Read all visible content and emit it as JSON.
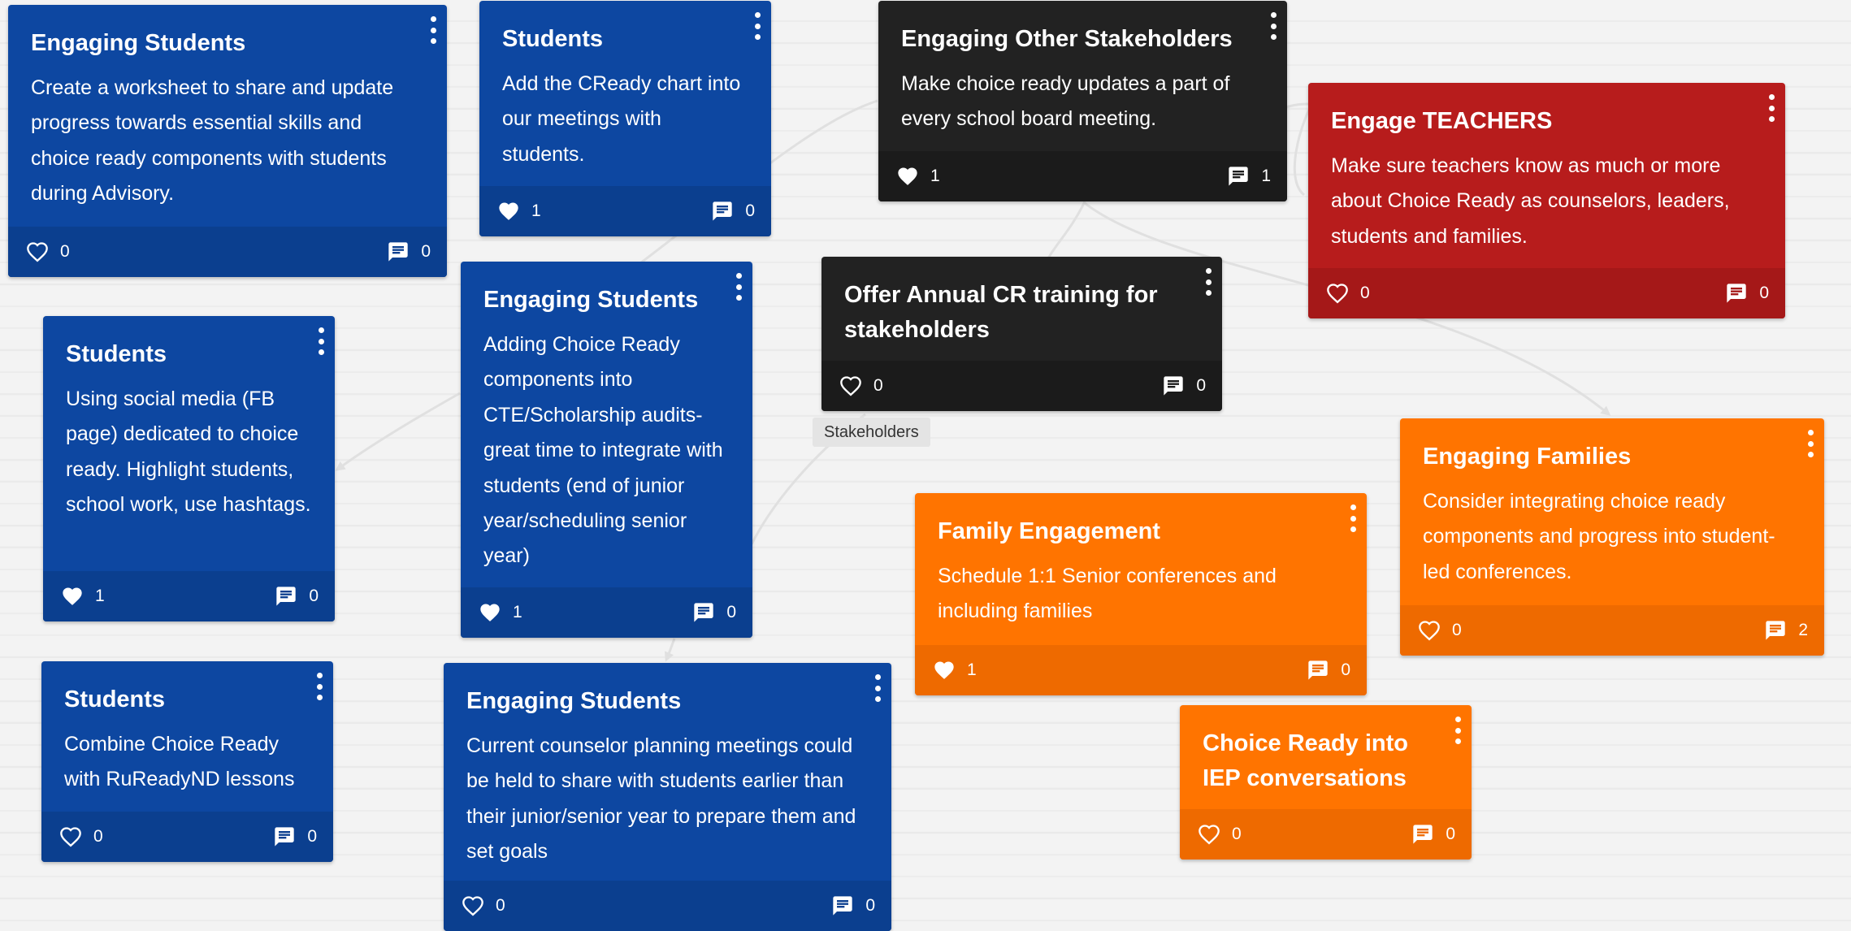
{
  "section_label": "Stakeholders",
  "colors": {
    "blue": "#0d47a1",
    "black": "#222222",
    "red": "#b71c1c",
    "orange": "#ff7400",
    "connector": "#e0e0e0"
  },
  "icons": {
    "like": "heart-icon",
    "comment": "comment-icon",
    "menu": "more-vert-icon"
  },
  "cards": [
    {
      "title": "Engaging Students",
      "text": "Create a worksheet to share and update progress towards essential skills and choice ready components with students during Advisory.",
      "likes": "0",
      "liked": false,
      "comments": "0"
    },
    {
      "title": "Students",
      "text": "Add the CReady chart into our meetings with students.",
      "likes": "1",
      "liked": true,
      "comments": "0"
    },
    {
      "title": "Engaging Other Stakeholders",
      "text": "Make choice ready updates a part of every school board meeting.",
      "likes": "1",
      "liked": true,
      "comments": "1"
    },
    {
      "title": "Engage TEACHERS",
      "text": "Make sure teachers know as much or more about Choice Ready as counselors, leaders, students and families.",
      "likes": "0",
      "liked": false,
      "comments": "0"
    },
    {
      "title": "Students",
      "text": "Using social media (FB page) dedicated to choice ready. Highlight students, school work, use hashtags.",
      "likes": "1",
      "liked": true,
      "comments": "0"
    },
    {
      "title": "Engaging Students",
      "text": "Adding Choice Ready components into CTE/Scholarship audits- great time to integrate with students (end of junior year/scheduling senior year)",
      "likes": "1",
      "liked": true,
      "comments": "0"
    },
    {
      "title": "Offer Annual CR training for stakeholders",
      "text": "",
      "likes": "0",
      "liked": false,
      "comments": "0"
    },
    {
      "title": "Engaging Families",
      "text": "Consider integrating choice ready components and progress into student-led conferences.",
      "likes": "0",
      "liked": false,
      "comments": "2"
    },
    {
      "title": "Family Engagement",
      "text": "Schedule 1:1 Senior conferences and including families",
      "likes": "1",
      "liked": true,
      "comments": "0"
    },
    {
      "title": "Students",
      "text": "Combine Choice Ready with  RuReadyND lessons",
      "likes": "0",
      "liked": false,
      "comments": "0"
    },
    {
      "title": "Engaging Students",
      "text": "Current  counselor  planning meetings could be held to share with students earlier than their junior/senior year to prepare them and set goals",
      "likes": "0",
      "liked": false,
      "comments": "0"
    },
    {
      "title": "Choice Ready into IEP conversations",
      "text": "",
      "likes": "0",
      "liked": false,
      "comments": "0"
    }
  ]
}
